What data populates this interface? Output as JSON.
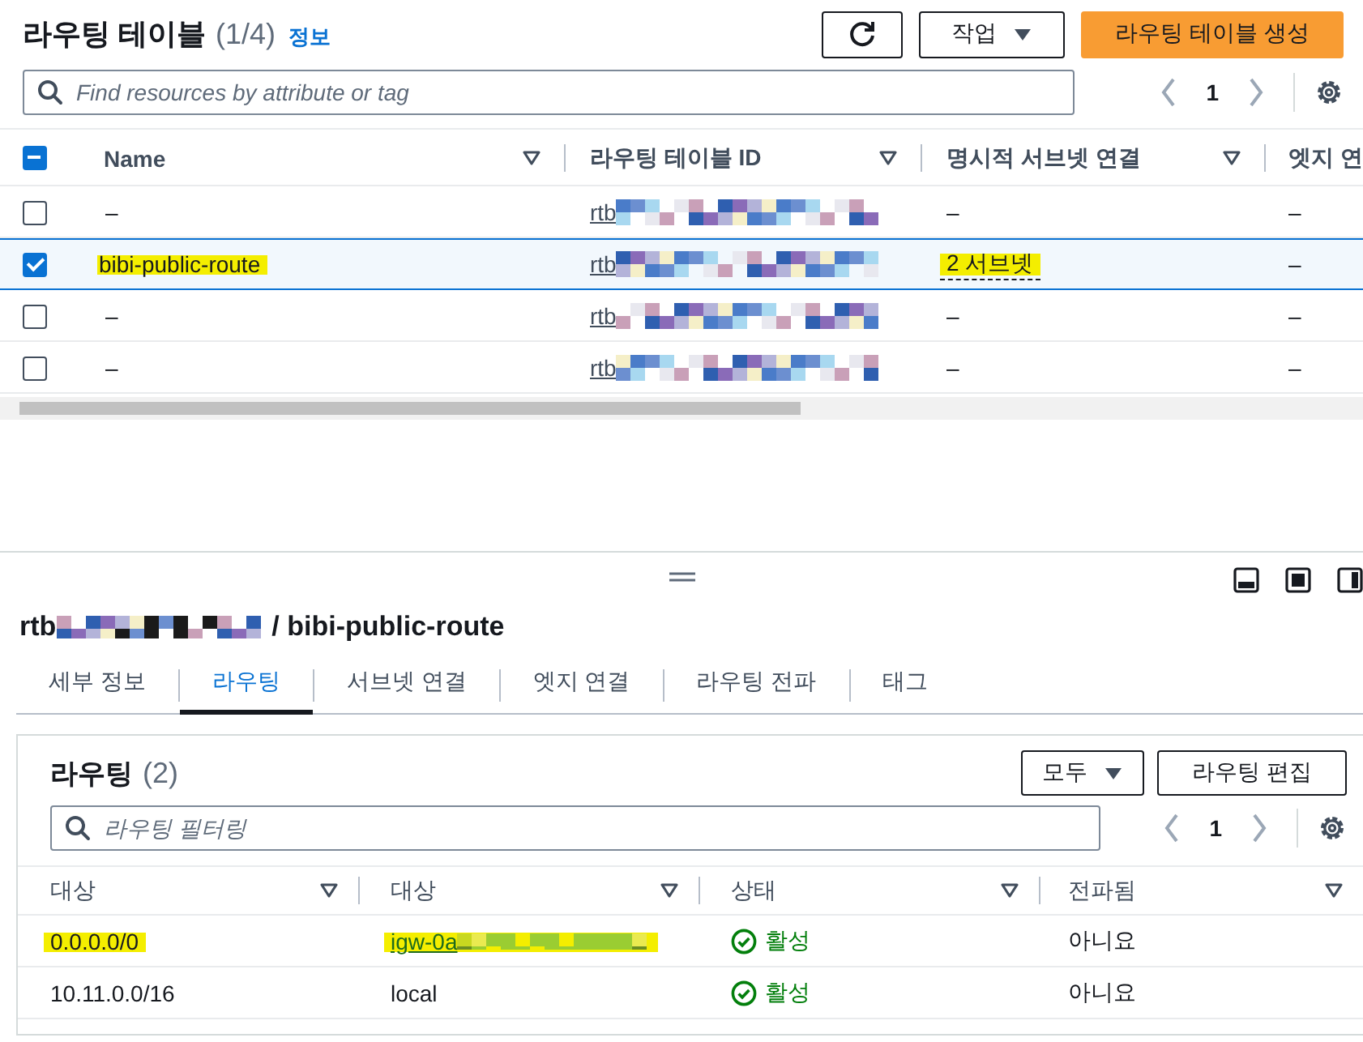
{
  "header": {
    "title": "라우팅 테이블",
    "count": "(1/4)",
    "info_link": "정보",
    "actions_button": "작업",
    "create_button": "라우팅 테이블 생성"
  },
  "search": {
    "placeholder": "Find resources by attribute or tag"
  },
  "pagination": {
    "page": "1"
  },
  "table": {
    "select_all_checked": true,
    "select_all_partial": true,
    "columns": [
      "Name",
      "라우팅 테이블 ID",
      "명시적 서브넷 연결",
      "엣지 연"
    ],
    "rows": [
      {
        "checked": false,
        "name": "–",
        "name_highlighted": false,
        "id": "rtb",
        "subnets": "–",
        "subnets_highlighted": false,
        "edge": "–"
      },
      {
        "checked": true,
        "name": "bibi-public-route",
        "name_highlighted": true,
        "id": "rtb",
        "subnets": "2 서브넷",
        "subnets_highlighted": true,
        "edge": "–"
      },
      {
        "checked": false,
        "name": "–",
        "name_highlighted": false,
        "id": "rtb",
        "subnets": "–",
        "subnets_highlighted": false,
        "edge": "–"
      },
      {
        "checked": false,
        "name": "–",
        "name_highlighted": false,
        "id": "rtb",
        "subnets": "–",
        "subnets_highlighted": false,
        "edge": "–"
      }
    ]
  },
  "detail": {
    "id_prefix": "rtb",
    "title": "/ bibi-public-route",
    "tabs": [
      {
        "label": "세부 정보",
        "selected": false
      },
      {
        "label": "라우팅",
        "selected": true
      },
      {
        "label": "서브넷 연결",
        "selected": false
      },
      {
        "label": "엣지 연결",
        "selected": false
      },
      {
        "label": "라우팅 전파",
        "selected": false
      },
      {
        "label": "태그",
        "selected": false
      }
    ],
    "routes": {
      "title": "라우팅",
      "count": "(2)",
      "filter_button": "모두",
      "edit_button": "라우팅 편집",
      "search_placeholder": "라우팅 필터링",
      "page": "1",
      "columns": [
        "대상",
        "대상",
        "상태",
        "전파됨"
      ],
      "rows": [
        {
          "destination": "0.0.0.0/0",
          "target": "igw-0a",
          "target_link": true,
          "status": "활성",
          "propagated": "아니요",
          "highlighted": true
        },
        {
          "destination": "10.11.0.0/16",
          "target": "local",
          "target_link": false,
          "status": "활성",
          "propagated": "아니요",
          "highlighted": false
        }
      ]
    }
  }
}
